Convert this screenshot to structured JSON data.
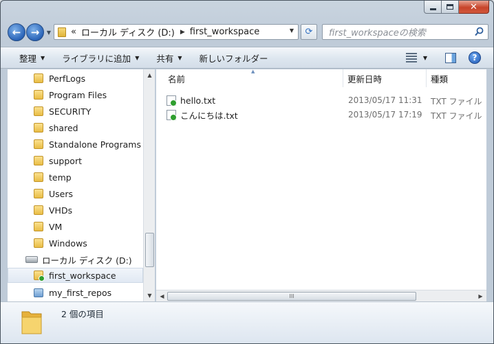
{
  "address": {
    "overflow": "«",
    "segments": [
      "ローカル ディスク (D:)",
      "first_workspace"
    ]
  },
  "search": {
    "placeholder": "first_workspaceの検索"
  },
  "toolbar": {
    "organize": "整理",
    "add_to_library": "ライブラリに追加",
    "share": "共有",
    "new_folder": "新しいフォルダー"
  },
  "tree": {
    "folders": [
      "PerfLogs",
      "Program Files",
      "SECURITY",
      "shared",
      "Standalone Programs",
      "support",
      "temp",
      "Users",
      "VHDs",
      "VM",
      "Windows"
    ],
    "drive": "ローカル ディスク (D:)",
    "selected": "first_workspace",
    "repo": "my_first_repos"
  },
  "columns": {
    "name": "名前",
    "modified": "更新日時",
    "type": "種類"
  },
  "files": [
    {
      "name": "hello.txt",
      "modified": "2013/05/17 11:31",
      "type": "TXT ファイル"
    },
    {
      "name": "こんにちは.txt",
      "modified": "2013/05/17 17:19",
      "type": "TXT ファイル"
    }
  ],
  "status": {
    "count_text": "2 個の項目"
  }
}
